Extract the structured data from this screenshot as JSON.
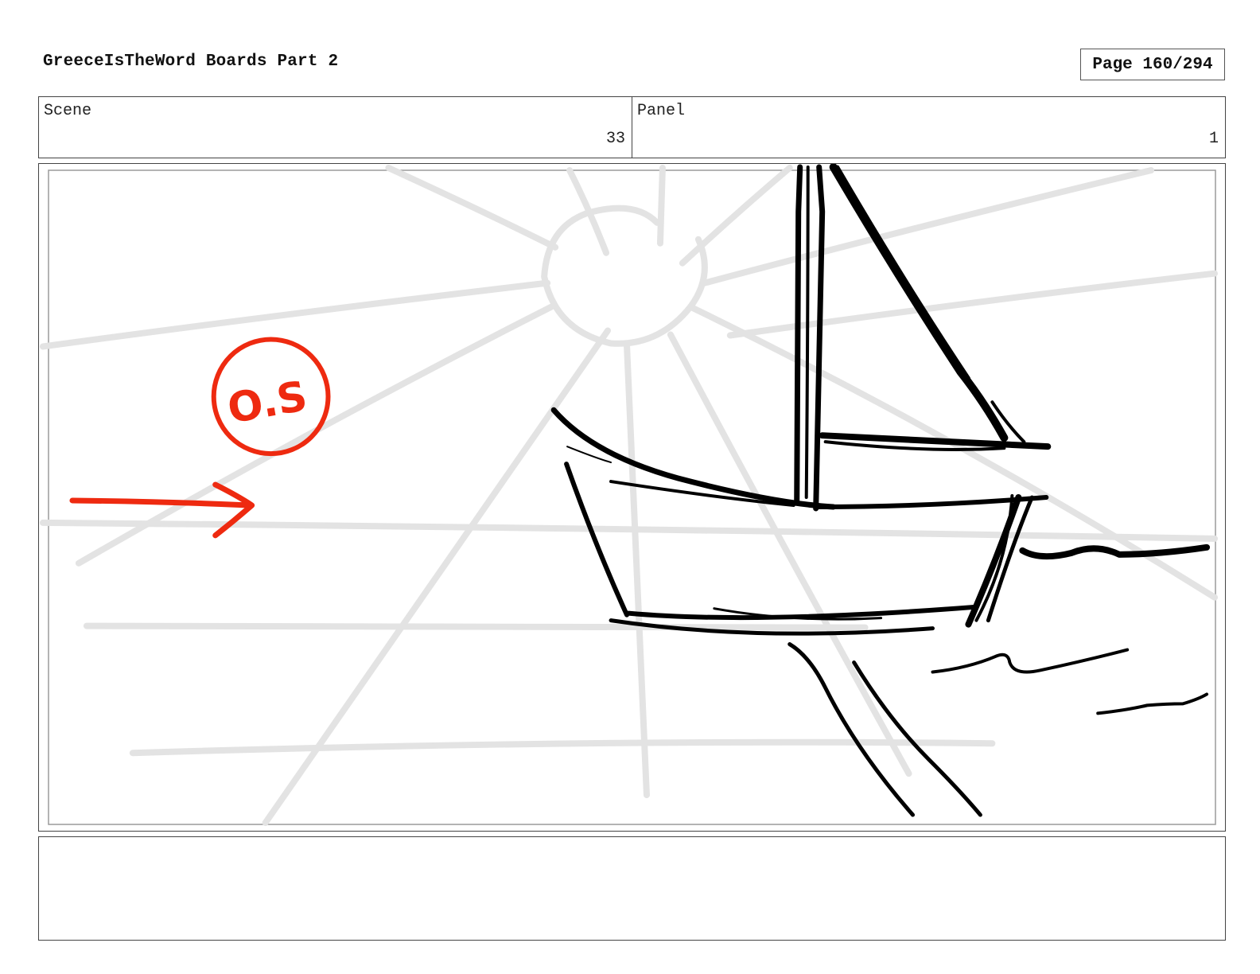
{
  "header": {
    "title": "GreeceIsTheWord Boards Part 2",
    "page": "Page 160/294"
  },
  "info": {
    "scene_label": "Scene",
    "scene_value": "33",
    "panel_label": "Panel",
    "panel_value": "1"
  },
  "panel": {
    "annotation": "O.S",
    "colors": {
      "ink": "#000000",
      "guide": "#e3e3e3",
      "annotation": "#ee2a10",
      "safe_frame": "#9a9a9a"
    }
  },
  "notes": {
    "text": ""
  }
}
